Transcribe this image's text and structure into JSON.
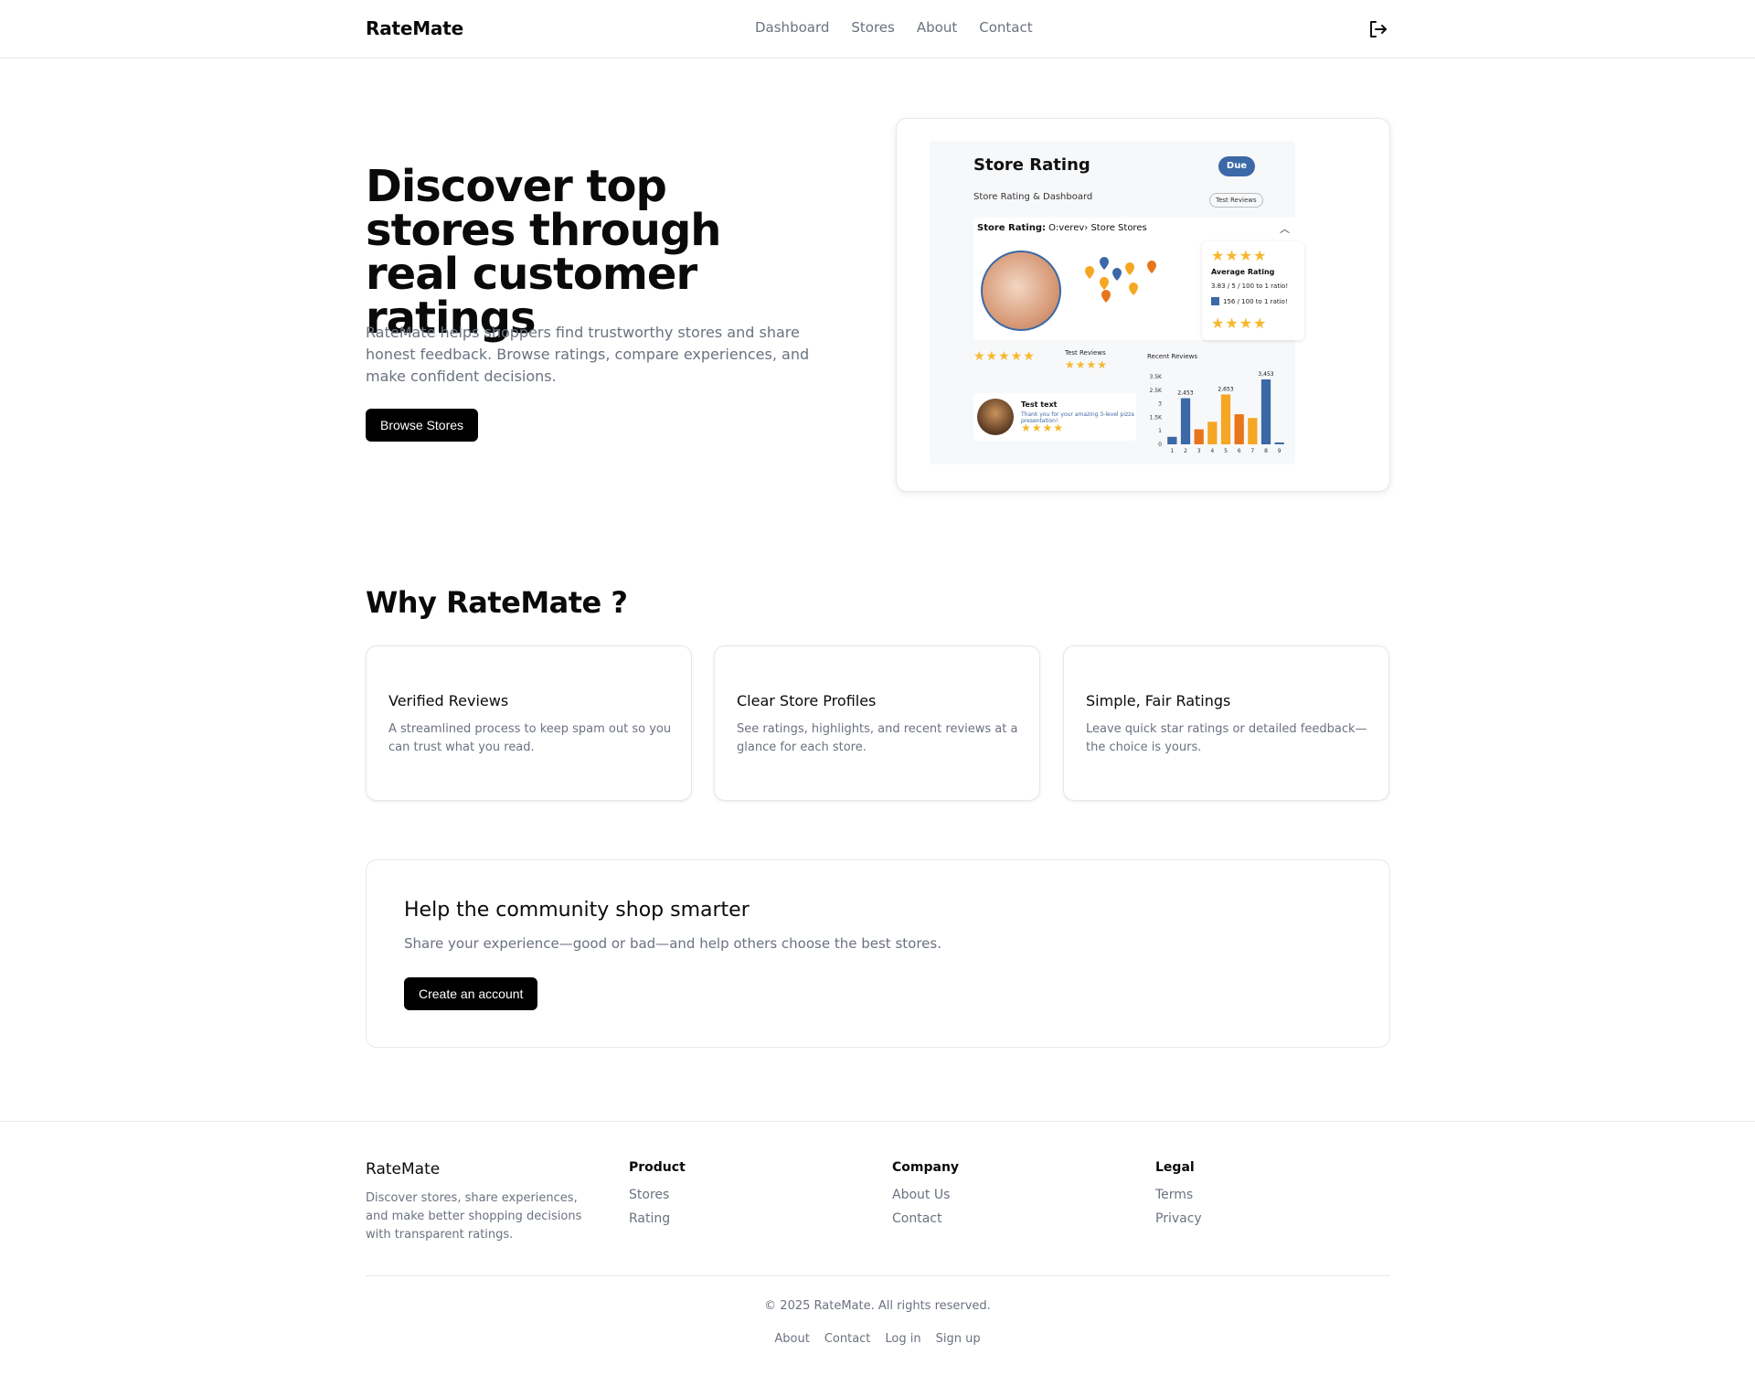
{
  "header": {
    "brand": "RateMate",
    "nav": [
      "Dashboard",
      "Stores",
      "About",
      "Contact"
    ],
    "logout_icon": "logout-icon"
  },
  "hero": {
    "title": "Discover top stores through real customer ratings",
    "subtitle": "RateMate helps shoppers find trustworthy stores and share honest feedback. Browse ratings, compare experiences, and make confident decisions.",
    "cta": "Browse Stores"
  },
  "preview": {
    "title": "Store Rating",
    "badge": "Due",
    "subtitle": "Store Rating & Dashboard",
    "test_reviews_btn": "Test Reviews",
    "panel_label_bold": "Store Rating:",
    "panel_label_rest": " O:verev› Store Stores",
    "avg_title": "Average Rating",
    "avg_line1": "3.83 / 5 / 100 to 1 ratio!",
    "avg_line2": "156 / 100 to 1 ratio!",
    "stars4": "★★★★",
    "stars5": "★★★★★",
    "test_reviews_label": "Test Reviews",
    "recent_reviews_label": "Recent Reviews",
    "test_text_title": "Test text",
    "test_text_body": "Thank you for your amazing 3-level pizza presentation!",
    "accent": "#3b68a6",
    "star_color": "#f5b82e"
  },
  "why": {
    "title": "Why RateMate ?",
    "features": [
      {
        "title": "Verified Reviews",
        "desc": "A streamlined process to keep spam out so you can trust what you read."
      },
      {
        "title": "Clear Store Profiles",
        "desc": "See ratings, highlights, and recent reviews at a glance for each store."
      },
      {
        "title": "Simple, Fair Ratings",
        "desc": "Leave quick star ratings or detailed feedback—the choice is yours."
      }
    ]
  },
  "cta": {
    "title": "Help the community shop smarter",
    "subtitle": "Share your experience—good or bad—and help others choose the best stores.",
    "button": "Create an account"
  },
  "footer": {
    "brand": "RateMate",
    "desc": "Discover stores, share experiences, and make better shopping decisions with transparent ratings.",
    "columns": [
      {
        "title": "Product",
        "links": [
          "Stores",
          "Rating"
        ]
      },
      {
        "title": "Company",
        "links": [
          "About Us",
          "Contact"
        ]
      },
      {
        "title": "Legal",
        "links": [
          "Terms",
          "Privacy"
        ]
      }
    ],
    "copyright": "© 2025 RateMate. All rights reserved.",
    "bottom_links": [
      "About",
      "Contact",
      "Log in",
      "Sign up"
    ]
  },
  "chart_data": {
    "type": "bar",
    "categories": [
      "1",
      "2",
      "3",
      "4",
      "5",
      "6",
      "7",
      "8",
      "9"
    ],
    "values": [
      0.4,
      2.453,
      0.8,
      1.2,
      2.653,
      1.6,
      1.4,
      3.453,
      0.1
    ],
    "colors": [
      "#3b68a6",
      "#3b68a6",
      "#e8751a",
      "#f5a623",
      "#f5a623",
      "#e8751a",
      "#f5a623",
      "#3b68a6",
      "#3b68a6"
    ],
    "data_labels": [
      "",
      "2,453",
      "",
      "",
      "2,653",
      "",
      "",
      "3,453",
      ""
    ],
    "yticks": [
      "0",
      "1",
      "1.5K",
      "3",
      "2.5K",
      "3.5K"
    ],
    "ylim": [
      0,
      3.6
    ]
  }
}
